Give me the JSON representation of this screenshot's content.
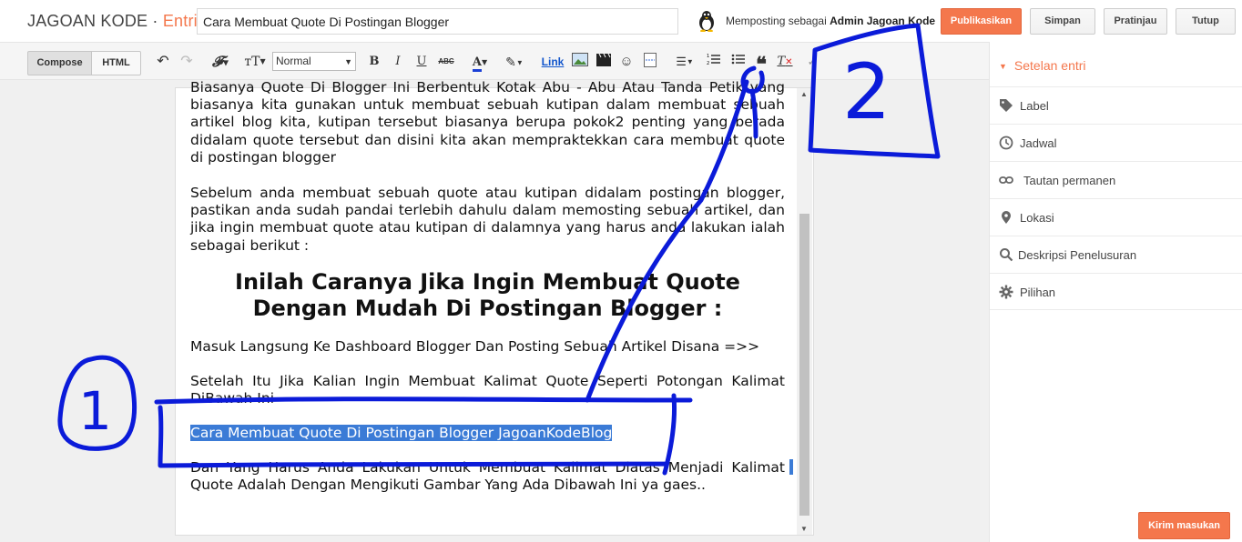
{
  "header": {
    "brand": "JAGOAN KODE",
    "separator": " · ",
    "section": "Entri",
    "post_title": "Cara Membuat Quote Di Postingan Blogger",
    "posting_as_prefix": "Memposting sebagai",
    "posting_as_user": "Admin Jagoan Kode",
    "publish_label": "Publikasikan",
    "save_label": "Simpan",
    "preview_label": "Pratinjau",
    "close_label": "Tutup"
  },
  "toolbar": {
    "compose_label": "Compose",
    "html_label": "HTML",
    "format_value": "Normal",
    "link_label": "Link"
  },
  "editor": {
    "p1": "Biasanya Quote Di Blogger Ini Berbentuk Kotak Abu - Abu Atau Tanda Petik yang biasanya kita gunakan untuk membuat sebuah kutipan dalam membuat sebuah artikel blog kita, kutipan tersebut biasanya berupa pokok2 penting yang berada didalam quote tersebut dan disini kita akan mempraktekkan cara membuat quote di postingan blogger",
    "p2": "Sebelum anda membuat sebuah quote atau kutipan didalam postingan blogger, pastikan anda sudah pandai terlebih dahulu dalam memosting sebuah artikel, dan jika ingin membuat quote atau kutipan di dalamnya yang harus anda lakukan ialah sebagai berikut :",
    "heading": "Inilah Caranya Jika Ingin Membuat Quote Dengan Mudah Di Postingan Blogger :",
    "p3": "Masuk Langsung Ke Dashboard Blogger Dan Posting Sebuah Artikel Disana =>>",
    "p4": "Setelah Itu Jika Kalian Ingin Membuat Kalimat Quote Seperti Potongan Kalimat DiBawah Ini",
    "p5_selected": "Cara Membuat Quote Di Postingan Blogger JagoanKodeBlog",
    "p6": "Dan Yang Harus Anda Lakukan Untuk Membuat Kalimat Diatas Menjadi Kalimat Quote Adalah Dengan Mengikuti Gambar Yang Ada Dibawah Ini ya gaes.."
  },
  "sidebar": {
    "title": "Setelan entri",
    "items": [
      {
        "label": "Label",
        "icon": "tag-icon"
      },
      {
        "label": "Jadwal",
        "icon": "clock-icon"
      },
      {
        "label": "Tautan permanen",
        "icon": "link-icon"
      },
      {
        "label": "Lokasi",
        "icon": "location-pin-icon"
      },
      {
        "label": "Deskripsi Penelusuran",
        "icon": "search-icon"
      },
      {
        "label": "Pilihan",
        "icon": "gear-icon"
      }
    ],
    "send_label": "Kirim masukan"
  },
  "annotations": {
    "label_1": "1",
    "label_2": "2",
    "color": "#0b1bd9"
  },
  "colors": {
    "accent": "#f4774c",
    "selection": "#3b7bd6",
    "link": "#1155cc"
  }
}
